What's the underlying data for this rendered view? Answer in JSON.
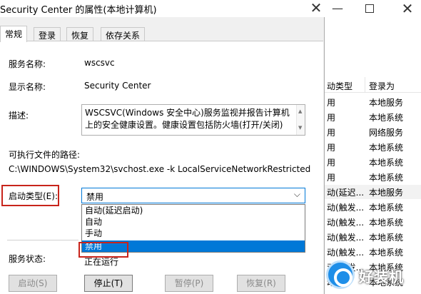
{
  "dialog": {
    "title": "Security Center 的属性(本地计算机)",
    "close_glyph": "✕",
    "tabs": [
      "常规",
      "登录",
      "恢复",
      "依存关系"
    ],
    "general": {
      "service_name_label": "服务名称:",
      "service_name": "wscsvc",
      "display_name_label": "显示名称:",
      "display_name": "Security Center",
      "description_label": "描述:",
      "description_line1": "WSCSVC(Windows 安全中心)服务监视并报告计算机",
      "description_line2": "上的安全健康设置。健康设置包括防火墙(打开/关闭)",
      "exe_path_label": "可执行文件的路径:",
      "exe_path": "C:\\WINDOWS\\System32\\svchost.exe -k LocalServiceNetworkRestricted",
      "startup_type_label": "启动类型(E):",
      "startup_type_value": "禁用",
      "startup_options": [
        "自动(延迟启动)",
        "自动",
        "手动",
        "禁用"
      ],
      "service_status_label": "服务状态:",
      "service_status": "正在运行"
    },
    "buttons": {
      "start": "启动(S)",
      "stop": "停止(T)",
      "pause": "暂停(P)",
      "resume": "恢复(R)"
    }
  },
  "background": {
    "window_controls": {
      "minimize": "—",
      "close": "✕"
    },
    "columns": {
      "startup_type": "动类型",
      "log_on_as": "登录为"
    },
    "rows": [
      {
        "startup": "用",
        "logon": "本地服务"
      },
      {
        "startup": "用",
        "logon": "本地系统"
      },
      {
        "startup": "用",
        "logon": "网络服务"
      },
      {
        "startup": "用",
        "logon": "本地系统"
      },
      {
        "startup": "用",
        "logon": "本地系统"
      },
      {
        "startup": "用",
        "logon": "本地系统"
      },
      {
        "startup": "动(延迟...",
        "logon": "本地服务"
      },
      {
        "startup": "动(触发...",
        "logon": "本地系统"
      },
      {
        "startup": "动(触发...",
        "logon": "本地系统"
      },
      {
        "startup": "动(触发...",
        "logon": "本地系统"
      },
      {
        "startup": "动(触发...",
        "logon": "本地系统"
      },
      {
        "startup": "动(触发...",
        "logon": "本地系统"
      },
      {
        "startup": "动",
        "logon": "本地系统"
      }
    ]
  },
  "watermark": {
    "text": "好装机"
  }
}
